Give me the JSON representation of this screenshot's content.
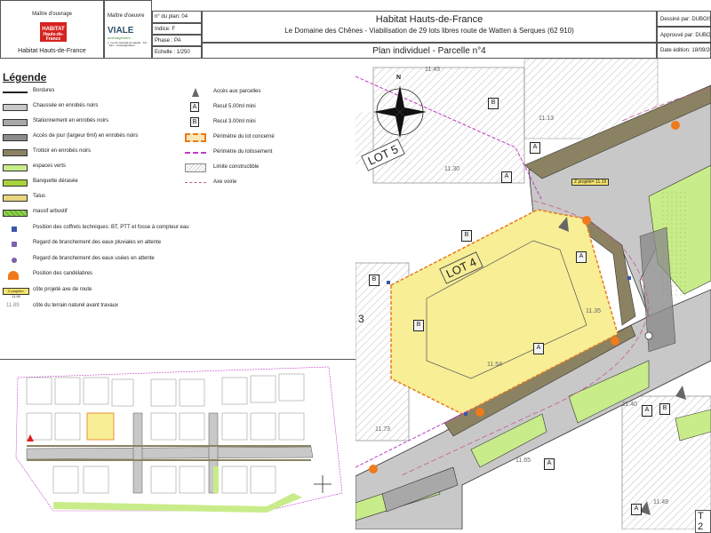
{
  "header": {
    "owner_title": "Maître d'ouvrage",
    "owner_logo_line1": "HABITAT",
    "owner_logo_line2": "Hauts-de-France",
    "owner_name": "Habitat Hauts-de-France",
    "designer_title": "Maître d'oeuvre",
    "designer_name": "VIALE",
    "designer_sub": "aménagement",
    "designer_addr": "1, rue du Général de Gaulle · Tél. · Fax · contact@viale.fr",
    "plan_no": "n° du plan: 04",
    "indice": "Indice: F",
    "phase": "Phase : PA",
    "echelle": "Echelle : 1/250",
    "main_title": "Habitat Hauts-de-France",
    "subtitle": "Le Domaine des Chênes - Viabilisation de 29 lots libres route de Watten à Serques (62 910)",
    "plan_title": "Plan individuel - Parcelle n°4",
    "drawn_by": "Dessiné par: DUBOIS",
    "approved_by": "Approuvé par: DUBOIS",
    "edition_date": "Date édition: 18/09/20"
  },
  "legend": {
    "title": "Légende",
    "left_items": [
      {
        "label": "Bordures",
        "color": "#222222"
      },
      {
        "label": "Chaussée en enrobés noirs",
        "color": "#c8c8c8"
      },
      {
        "label": "Stationnement en enrobés noirs",
        "color": "#a8a8a8"
      },
      {
        "label": "Accès de jour (largeur 6ml) en enrobés noirs",
        "color": "#8c8c8c"
      },
      {
        "label": "Trottoir en enrobés noirs",
        "color": "#8a8262"
      },
      {
        "label": "espaces verts",
        "color": "#c9ec8a"
      },
      {
        "label": "Banquette dérasée",
        "color": "#a7d23e"
      },
      {
        "label": "Talus",
        "color": "#e9d57d"
      },
      {
        "label": "massif arbustif",
        "color": "#6cb62f"
      },
      {
        "label": "Position des coffrets techniques: BT, PTT et fosse à compteur eau",
        "color": "#3b56a8"
      },
      {
        "label": "Regard de branchement des eaux pluviales en attente",
        "color": "#7c61a7"
      },
      {
        "label": "Regard de branchement des eaux usées en attente",
        "color": "#7c61a7"
      },
      {
        "label": "Position des candélabres",
        "color": "#f07a1c"
      },
      {
        "label": "côte projeté axe de route",
        "sample": "Z projeté= 11.90",
        "color": "#f4e36a"
      },
      {
        "label": "côte du terrain naturel avant travaux",
        "sample": "11.89",
        "color": "#666666"
      }
    ],
    "right_items": [
      {
        "label": "Accès aux parcelles",
        "symbol": "triangle"
      },
      {
        "label": "Recul 5.00ml mini",
        "symbol": "A"
      },
      {
        "label": "Recul 3.00ml mini",
        "symbol": "B"
      },
      {
        "label": "Périmètre du lot concerné",
        "symbol": "dash-orange"
      },
      {
        "label": "Périmètre du lotissement",
        "symbol": "dash-magenta"
      },
      {
        "label": "Limite constructible",
        "symbol": "hatch"
      },
      {
        "label": "Axe voirie",
        "symbol": "axis"
      }
    ]
  },
  "plan": {
    "compass": "N",
    "lot4_label": "LOT 4",
    "lot5_label": "LOT 5",
    "lot3_label": "3",
    "lot2_label": "T 2",
    "z_label": "Z projeté= 11.19",
    "spot_levels": [
      "11.43",
      "11.13",
      "11.30",
      "11.35",
      "11.54",
      "11.73",
      "11.40",
      "11.65",
      "11.49"
    ],
    "letter_A": "A",
    "letter_B": "B"
  },
  "colors": {
    "road": "#c8c8c8",
    "sidewalk": "#8a8262",
    "green": "#c9ec8a",
    "lot_fill": "#f7ee96",
    "lot_border": "#e87c1c",
    "magenta": "#c23cc8"
  }
}
